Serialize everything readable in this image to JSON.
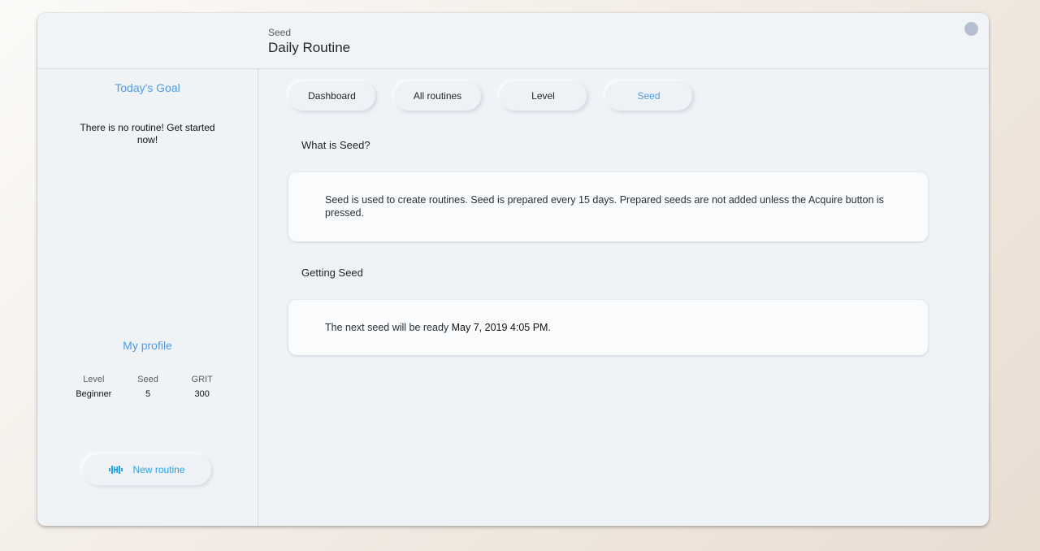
{
  "header": {
    "subtitle": "Seed",
    "title": "Daily Routine"
  },
  "sidebar": {
    "goal_title": "Today's Goal",
    "goal_text": "There is no routine! Get started now!",
    "profile_title": "My profile",
    "stats": [
      {
        "label": "Level",
        "value": "Beginner"
      },
      {
        "label": "Seed",
        "value": "5"
      },
      {
        "label": "GRIT",
        "value": "300"
      }
    ],
    "new_routine_label": "New routine",
    "new_routine_icon": "dumbbell-icon"
  },
  "tabs": [
    {
      "label": "Dashboard",
      "active": false
    },
    {
      "label": "All routines",
      "active": false
    },
    {
      "label": "Level",
      "active": false
    },
    {
      "label": "Seed",
      "active": true
    }
  ],
  "content": {
    "what_title": "What is Seed?",
    "what_text": "Seed is used to create routines. Seed is prepared every 15 days. Prepared seeds are not added unless the Acquire button is pressed.",
    "getting_title": "Getting Seed",
    "next_prefix": "The next seed will be ready ",
    "next_date": "May 7, 2019 4:05 PM",
    "next_suffix": "."
  },
  "colors": {
    "accent": "#4b9be6",
    "new_routine": "#29a3e0",
    "window_bg": "#eff2f6",
    "card_bg": "#f9fbfd"
  }
}
